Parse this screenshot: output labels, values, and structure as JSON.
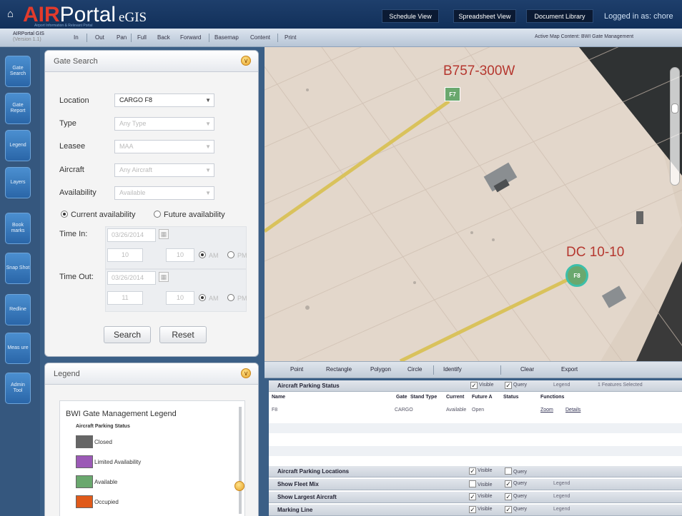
{
  "header": {
    "logo_air": "AIR",
    "logo_portal": "Portal",
    "logo_egis": "eGIS",
    "logo_sub": "Airport Information & Relevant Portal",
    "buttons": [
      "Schedule View",
      "Spreadsheet View",
      "Document Library"
    ],
    "login_text": "Logged in as: chore"
  },
  "toolbar": {
    "app_name": "AIRPortal GIS",
    "app_version": "(Version 1.1)",
    "items": [
      "In",
      "Out",
      "Pan",
      "Full",
      "Back",
      "Forward",
      "Basemap",
      "Content",
      "Print"
    ],
    "right_text": "Active Map Content: BWI Gate Management"
  },
  "leftnav": [
    "Gate Search",
    "Gate Report",
    "Legend",
    "Layers",
    "Book marks",
    "Snap Shot",
    "Redline",
    "Meas ure",
    "Admin Tool"
  ],
  "gate_search": {
    "title": "Gate Search",
    "location_label": "Location",
    "location_value": "CARGO F8",
    "type_label": "Type",
    "type_value": "Any Type",
    "leasee_label": "Leasee",
    "leasee_value": "MAA",
    "aircraft_label": "Aircraft",
    "aircraft_value": "Any Aircraft",
    "availability_label": "Availability",
    "availability_value": "Available",
    "radio_current": "Current availability",
    "radio_future": "Future availability",
    "time_in_label": "Time In:",
    "time_in_date": "03/26/2014",
    "time_in_hour": "10",
    "time_in_min": "10",
    "time_out_label": "Time Out:",
    "time_out_date": "03/26/2014",
    "time_out_hour": "11",
    "time_out_min": "10",
    "am": "AM",
    "pm": "PM",
    "search_button": "Search",
    "reset_button": "Reset"
  },
  "legend": {
    "title": "Legend",
    "inner_title": "BWI Gate Management Legend",
    "subtitle": "Aircraft Parking Status",
    "items": [
      {
        "label": "Closed",
        "color": "#666666"
      },
      {
        "label": "Limited Availability",
        "color": "#9b59b6"
      },
      {
        "label": "Available",
        "color": "#6aa86e"
      },
      {
        "label": "Occupied",
        "color": "#e05a1a"
      }
    ]
  },
  "map": {
    "label_top": "B757-300W",
    "label_right": "DC 10-10",
    "gate_top": "F7",
    "gate_selected": "F8"
  },
  "tools": [
    "Point",
    "Rectangle",
    "Polygon",
    "Circle",
    "Identify",
    "Clear",
    "Export"
  ],
  "grid": {
    "parking_status": {
      "title": "Aircraft Parking Status",
      "visible": "Visible",
      "query": "Query",
      "legend": "Legend",
      "selected": "1 Features Selected",
      "columns": [
        "Name",
        "Gate",
        "Stand Type",
        "Current",
        "Future A",
        "Status",
        "Functions"
      ],
      "row": {
        "name": "F8",
        "stand_type": "CARGO",
        "current": "Available",
        "future": "Open",
        "zoom": "Zoom",
        "details": "Details"
      }
    },
    "layers": [
      {
        "title": "Aircraft Parking Locations",
        "visible": "Visible",
        "query": "Query",
        "legend": ""
      },
      {
        "title": "Show Fleet Mix",
        "visible": "Visible",
        "query": "Query",
        "legend": "Legend"
      },
      {
        "title": "Show Largest Aircraft",
        "visible": "Visible",
        "query": "Query",
        "legend": "Legend"
      },
      {
        "title": "Marking Line",
        "visible": "Visible",
        "query": "Query",
        "legend": "Legend"
      }
    ]
  }
}
